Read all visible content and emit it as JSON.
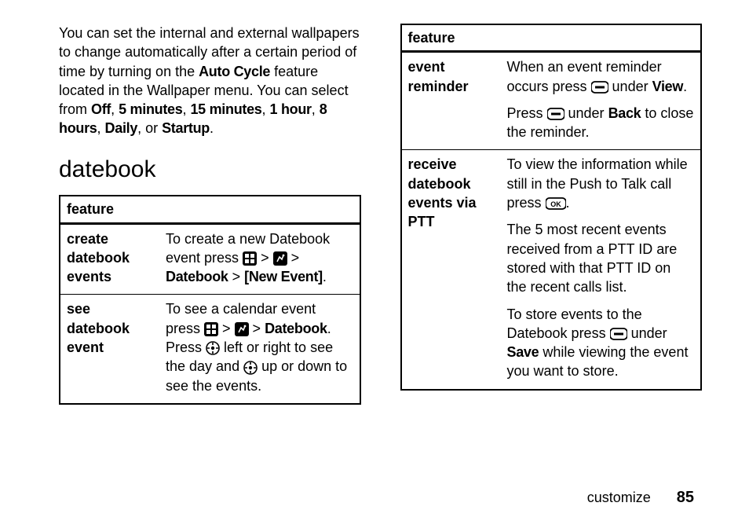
{
  "intro": {
    "p1_a": "You can set the internal and external wallpapers to change automatically after a certain period of time by turning on the ",
    "auto_cycle": "Auto Cycle",
    "p1_b": " feature located in the Wallpaper menu. You can select from ",
    "opts": [
      "Off",
      "5 minutes",
      "15 minutes",
      "1 hour",
      "8 hours",
      "Daily",
      "Startup"
    ],
    "sep": ", ",
    "or": ", or ",
    "period": "."
  },
  "section_title": "datebook",
  "table_header": "feature",
  "left_rows": [
    {
      "name": "create datebook events",
      "d1a": "To create a new Datebook event press ",
      "d1b": " > ",
      "d1c": " > ",
      "d1d": "Datebook",
      "d1e": " > ",
      "d1f": "[New Event]",
      "d1g": "."
    },
    {
      "name": "see datebook event",
      "d1a": "To see a calendar event press ",
      "d1b": " > ",
      "d1c": " > ",
      "d1d": "Datebook",
      "d1e": ". Press ",
      "d1f": " left or right to see the day and ",
      "d1g": " up or down to see the events."
    }
  ],
  "right_rows": [
    {
      "name": "event reminder",
      "p1a": "When an event reminder occurs press ",
      "p1b": " under ",
      "p1c": "View",
      "p1d": ".",
      "p2a": "Press ",
      "p2b": " under ",
      "p2c": "Back",
      "p2d": " to close the reminder."
    },
    {
      "name": "receive datebook events via PTT",
      "p1a": "To view the information while still in the Push to Talk call press ",
      "p1d": ".",
      "p2": "The 5 most recent events received from a PTT ID are stored with that PTT ID on the recent calls list.",
      "p3a": "To store events to the Datebook press ",
      "p3b": " under ",
      "p3c": "Save",
      "p3d": " while viewing the event you want to store."
    }
  ],
  "footer": {
    "label": "customize",
    "page": "85"
  }
}
